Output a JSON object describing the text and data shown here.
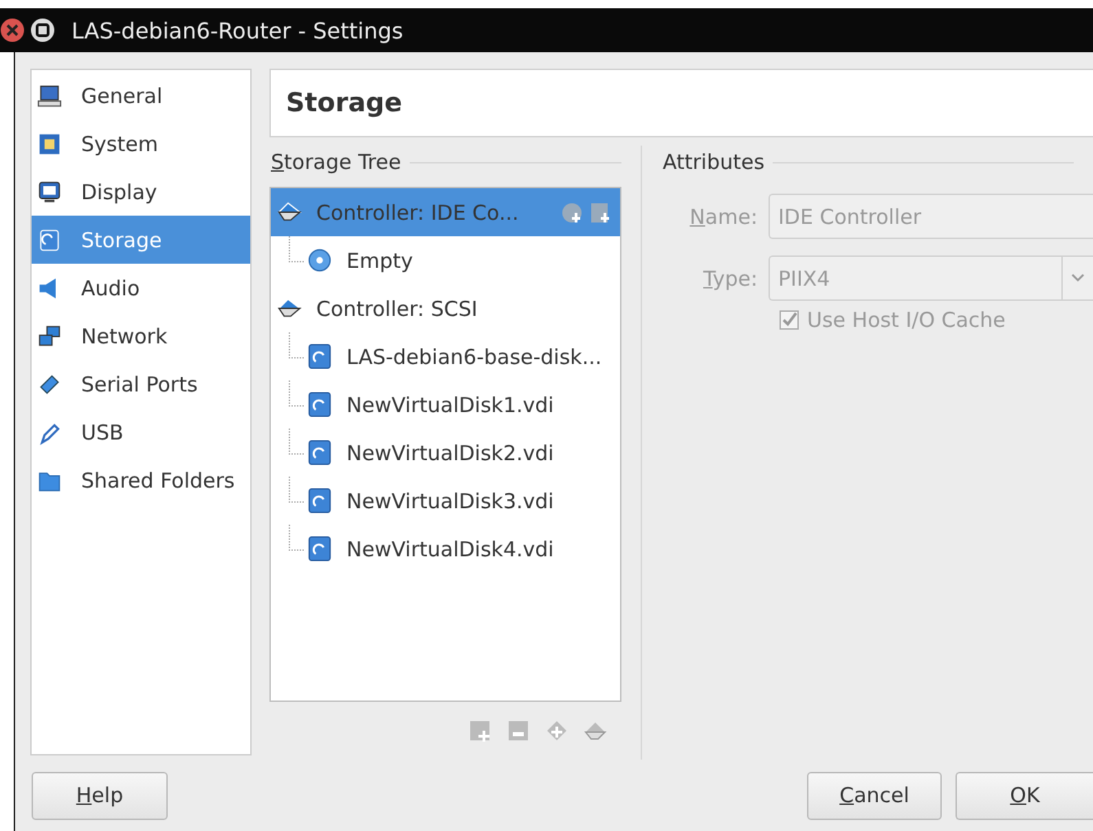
{
  "window": {
    "title": "LAS-debian6-Router - Settings"
  },
  "sidebar": {
    "items": [
      {
        "label": "General",
        "selected": false
      },
      {
        "label": "System",
        "selected": false
      },
      {
        "label": "Display",
        "selected": false
      },
      {
        "label": "Storage",
        "selected": true
      },
      {
        "label": "Audio",
        "selected": false
      },
      {
        "label": "Network",
        "selected": false
      },
      {
        "label": "Serial Ports",
        "selected": false
      },
      {
        "label": "USB",
        "selected": false
      },
      {
        "label": "Shared Folders",
        "selected": false
      }
    ]
  },
  "page_title": "Storage",
  "storage_tree": {
    "label": "Storage Tree",
    "mnemonic": true,
    "items": [
      {
        "label": "Controller: IDE Co...",
        "kind": "controller",
        "selected": true,
        "children": [
          {
            "label": "Empty",
            "kind": "optical",
            "selected": false
          }
        ]
      },
      {
        "label": "Controller: SCSI",
        "kind": "controller",
        "selected": false,
        "children": [
          {
            "label": "LAS-debian6-base-disk...",
            "kind": "disk",
            "selected": false
          },
          {
            "label": "NewVirtualDisk1.vdi",
            "kind": "disk",
            "selected": false
          },
          {
            "label": "NewVirtualDisk2.vdi",
            "kind": "disk",
            "selected": false
          },
          {
            "label": "NewVirtualDisk3.vdi",
            "kind": "disk",
            "selected": false
          },
          {
            "label": "NewVirtualDisk4.vdi",
            "kind": "disk",
            "selected": false
          }
        ]
      }
    ]
  },
  "attributes": {
    "label": "Attributes",
    "name": {
      "label": "Name:",
      "mnemonic": true,
      "value": "IDE Controller",
      "disabled": true
    },
    "type": {
      "label": "Type:",
      "mnemonic": true,
      "value": "PIIX4",
      "disabled": true
    },
    "host_cache": {
      "label": "Use Host I/O Cache",
      "checked": true,
      "disabled": true
    }
  },
  "buttons": [
    {
      "label": "Help",
      "mnemonic": true,
      "kind": "help"
    },
    {
      "label": "Cancel",
      "mnemonic": true,
      "kind": "action"
    },
    {
      "label": "OK",
      "mnemonic": true,
      "kind": "action"
    }
  ]
}
